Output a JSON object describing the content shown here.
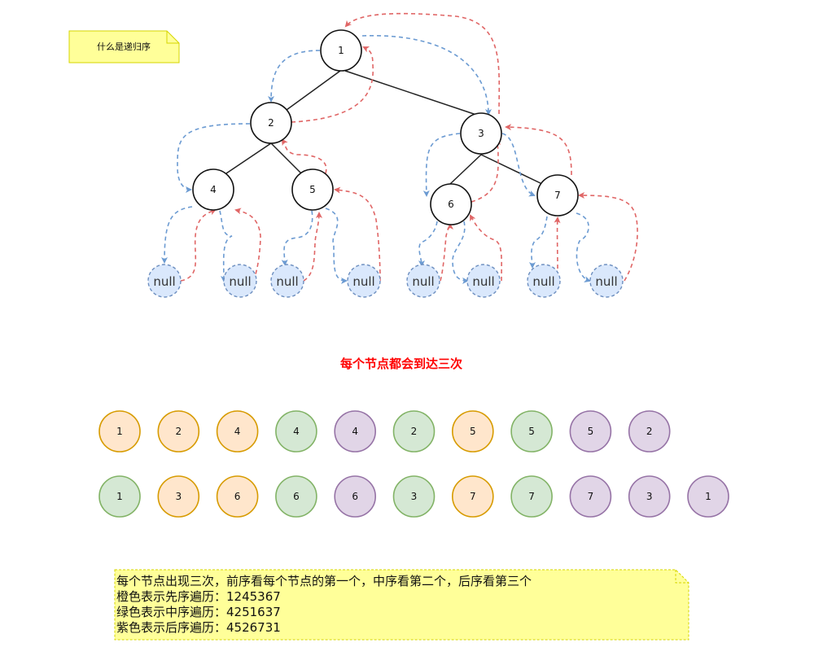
{
  "sticky_note": {
    "text": "什么是递归序"
  },
  "tree": {
    "nodes": [
      {
        "id": "n1",
        "label": "1"
      },
      {
        "id": "n2",
        "label": "2"
      },
      {
        "id": "n3",
        "label": "3"
      },
      {
        "id": "n4",
        "label": "4"
      },
      {
        "id": "n5",
        "label": "5"
      },
      {
        "id": "n6",
        "label": "6"
      },
      {
        "id": "n7",
        "label": "7"
      }
    ],
    "null_label": "null"
  },
  "heading": "每个节点都会到达三次",
  "sequence_row1": [
    {
      "label": "1",
      "color": "orange"
    },
    {
      "label": "2",
      "color": "orange"
    },
    {
      "label": "4",
      "color": "orange"
    },
    {
      "label": "4",
      "color": "green"
    },
    {
      "label": "4",
      "color": "purple"
    },
    {
      "label": "2",
      "color": "green"
    },
    {
      "label": "5",
      "color": "orange"
    },
    {
      "label": "5",
      "color": "green"
    },
    {
      "label": "5",
      "color": "purple"
    },
    {
      "label": "2",
      "color": "purple"
    }
  ],
  "sequence_row2": [
    {
      "label": "1",
      "color": "green"
    },
    {
      "label": "3",
      "color": "orange"
    },
    {
      "label": "6",
      "color": "orange"
    },
    {
      "label": "6",
      "color": "green"
    },
    {
      "label": "6",
      "color": "purple"
    },
    {
      "label": "3",
      "color": "green"
    },
    {
      "label": "7",
      "color": "orange"
    },
    {
      "label": "7",
      "color": "green"
    },
    {
      "label": "7",
      "color": "purple"
    },
    {
      "label": "3",
      "color": "purple"
    },
    {
      "label": "1",
      "color": "purple"
    }
  ],
  "colors": {
    "orange": {
      "fill": "#ffe6cc",
      "stroke": "#d79b00"
    },
    "green": {
      "fill": "#d5e8d4",
      "stroke": "#82b366"
    },
    "purple": {
      "fill": "#e1d5e7",
      "stroke": "#9673a6"
    },
    "null_fill": "#dae8fc",
    "null_stroke": "#6c8ebf",
    "blue_arrow": "#6c9bd2",
    "red_arrow": "#e06666",
    "note_fill": "#ffff99",
    "note_stroke": "#d6d600"
  },
  "bottom_note": {
    "line1": "每个节点出现三次，前序看每个节点的第一个，中序看第二个，后序看第三个",
    "line2": "橙色表示先序遍历：1245367",
    "line3": "绿色表示中序遍历：4251637",
    "line4": "紫色表示后序遍历：4526731"
  }
}
